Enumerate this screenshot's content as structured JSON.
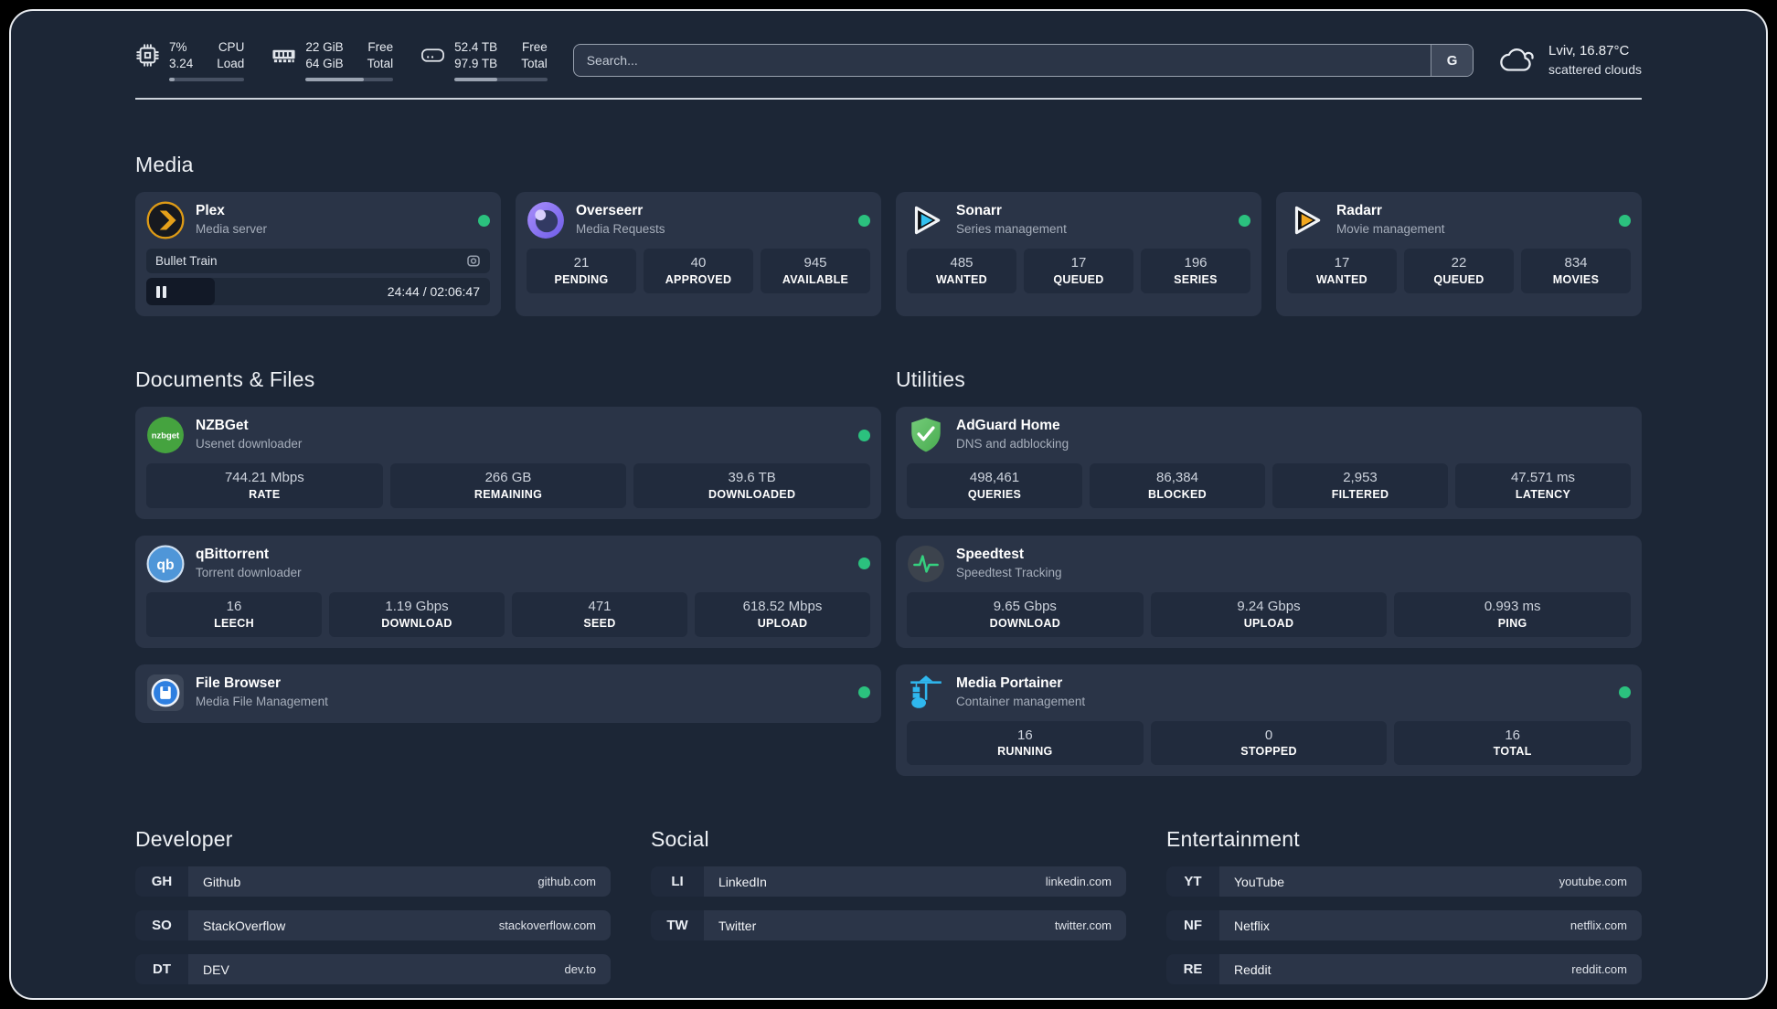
{
  "colors": {
    "status_online": "#2bc17e",
    "plex_accent": "#e5a01a",
    "overseerr_accent": "#8b78ee",
    "sonarr_accent": "#33c1f0",
    "radarr_accent": "#f2a71f",
    "nzbget_accent": "#45a33f",
    "qbittorrent_accent": "#4f96d8",
    "filebrowser_accent": "#2e7fe0",
    "adguard_accent": "#5cbb62",
    "speedtest_accent": "#35d07f",
    "portainer_accent": "#2fb7ee"
  },
  "header": {
    "resources": [
      {
        "icon": "cpu-icon",
        "col1_top": "7%",
        "col1_bottom": "3.24",
        "col2_top": "CPU",
        "col2_bottom": "Load",
        "percent": 7
      },
      {
        "icon": "memory-icon",
        "col1_top": "22 GiB",
        "col1_bottom": "64 GiB",
        "col2_top": "Free",
        "col2_bottom": "Total",
        "percent": 66
      },
      {
        "icon": "disk-icon",
        "col1_top": "52.4 TB",
        "col1_bottom": "97.9 TB",
        "col2_top": "Free",
        "col2_bottom": "Total",
        "percent": 46
      }
    ],
    "search": {
      "placeholder": "Search...",
      "button": "G"
    },
    "weather": {
      "line1": "Lviv, 16.87°C",
      "line2": "scattered clouds"
    }
  },
  "groups": [
    {
      "title": "Media",
      "services": [
        {
          "name": "Plex",
          "description": "Media server",
          "online": true,
          "player": {
            "title": "Bullet Train",
            "time": "24:44 / 02:06:47",
            "progress_percent": 20
          }
        },
        {
          "name": "Overseerr",
          "description": "Media Requests",
          "online": true,
          "stats": [
            {
              "value": "21",
              "label": "PENDING"
            },
            {
              "value": "40",
              "label": "APPROVED"
            },
            {
              "value": "945",
              "label": "AVAILABLE"
            }
          ]
        },
        {
          "name": "Sonarr",
          "description": "Series management",
          "online": true,
          "stats": [
            {
              "value": "485",
              "label": "WANTED"
            },
            {
              "value": "17",
              "label": "QUEUED"
            },
            {
              "value": "196",
              "label": "SERIES"
            }
          ]
        },
        {
          "name": "Radarr",
          "description": "Movie management",
          "online": true,
          "stats": [
            {
              "value": "17",
              "label": "WANTED"
            },
            {
              "value": "22",
              "label": "QUEUED"
            },
            {
              "value": "834",
              "label": "MOVIES"
            }
          ]
        }
      ]
    },
    {
      "title": "Documents & Files",
      "services": [
        {
          "name": "NZBGet",
          "description": "Usenet downloader",
          "online": true,
          "icon_text": "nzbget",
          "stats": [
            {
              "value": "744.21 Mbps",
              "label": "RATE"
            },
            {
              "value": "266 GB",
              "label": "REMAINING"
            },
            {
              "value": "39.6 TB",
              "label": "DOWNLOADED"
            }
          ]
        },
        {
          "name": "qBittorrent",
          "description": "Torrent downloader",
          "online": true,
          "icon_text": "qb",
          "stats": [
            {
              "value": "16",
              "label": "LEECH"
            },
            {
              "value": "1.19 Gbps",
              "label": "DOWNLOAD"
            },
            {
              "value": "471",
              "label": "SEED"
            },
            {
              "value": "618.52 Mbps",
              "label": "UPLOAD"
            }
          ]
        },
        {
          "name": "File Browser",
          "description": "Media File Management",
          "online": true
        }
      ]
    },
    {
      "title": "Utilities",
      "services": [
        {
          "name": "AdGuard Home",
          "description": "DNS and adblocking",
          "online": false,
          "stats": [
            {
              "value": "498,461",
              "label": "QUERIES"
            },
            {
              "value": "86,384",
              "label": "BLOCKED"
            },
            {
              "value": "2,953",
              "label": "FILTERED"
            },
            {
              "value": "47.571 ms",
              "label": "LATENCY"
            }
          ]
        },
        {
          "name": "Speedtest",
          "description": "Speedtest Tracking",
          "online": false,
          "stats": [
            {
              "value": "9.65 Gbps",
              "label": "DOWNLOAD"
            },
            {
              "value": "9.24 Gbps",
              "label": "UPLOAD"
            },
            {
              "value": "0.993 ms",
              "label": "PING"
            }
          ]
        },
        {
          "name": "Media Portainer",
          "description": "Container management",
          "online": true,
          "stats": [
            {
              "value": "16",
              "label": "RUNNING"
            },
            {
              "value": "0",
              "label": "STOPPED"
            },
            {
              "value": "16",
              "label": "TOTAL"
            }
          ]
        }
      ]
    }
  ],
  "bookmark_groups": [
    {
      "title": "Developer",
      "items": [
        {
          "abbr": "GH",
          "name": "Github",
          "url": "github.com"
        },
        {
          "abbr": "SO",
          "name": "StackOverflow",
          "url": "stackoverflow.com"
        },
        {
          "abbr": "DT",
          "name": "DEV",
          "url": "dev.to"
        }
      ]
    },
    {
      "title": "Social",
      "items": [
        {
          "abbr": "LI",
          "name": "LinkedIn",
          "url": "linkedin.com"
        },
        {
          "abbr": "TW",
          "name": "Twitter",
          "url": "twitter.com"
        }
      ]
    },
    {
      "title": "Entertainment",
      "items": [
        {
          "abbr": "YT",
          "name": "YouTube",
          "url": "youtube.com"
        },
        {
          "abbr": "NF",
          "name": "Netflix",
          "url": "netflix.com"
        },
        {
          "abbr": "RE",
          "name": "Reddit",
          "url": "reddit.com"
        }
      ]
    }
  ]
}
